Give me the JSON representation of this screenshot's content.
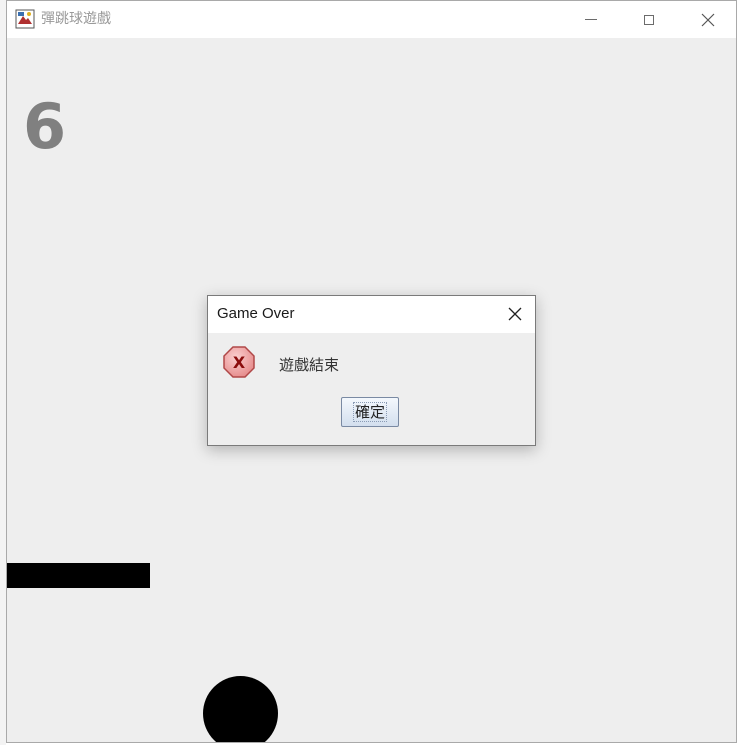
{
  "window": {
    "title": "彈跳球遊戲",
    "controls": {
      "minimize_icon": "minimize-icon",
      "maximize_icon": "maximize-icon",
      "close_icon": "close-icon"
    }
  },
  "game": {
    "score": "6",
    "colors": {
      "background": "#eeeeee",
      "score": "#808080",
      "paddle": "#000000",
      "ball": "#000000"
    }
  },
  "dialog": {
    "title": "Game Over",
    "message": "遊戲結束",
    "ok_label": "確定",
    "icon": "error-icon",
    "icon_glyph": "X"
  }
}
